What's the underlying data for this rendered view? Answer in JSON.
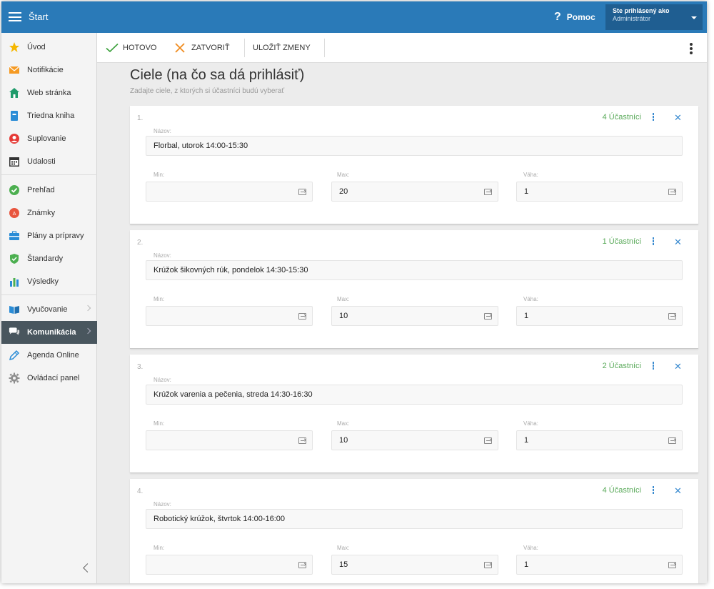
{
  "topbar": {
    "title": "Štart",
    "help_icon": "?",
    "help_label": "Pomoc",
    "user_line1": "Ste prihlásený ako",
    "user_line2": "Administrátor",
    "bg_color": "#2a7ab8"
  },
  "sidebar": {
    "items": [
      {
        "label": "Úvod",
        "icon": "star-icon"
      },
      {
        "label": "Notifikácie",
        "icon": "envelope-icon"
      },
      {
        "label": "Web stránka",
        "icon": "home-icon"
      },
      {
        "label": "Triedna kniha",
        "icon": "book-icon"
      },
      {
        "label": "Suplovanie",
        "icon": "substitute-icon"
      },
      {
        "label": "Udalosti",
        "icon": "calendar-icon"
      },
      {
        "label": "Prehľad",
        "icon": "check-circle-icon"
      },
      {
        "label": "Známky",
        "icon": "grades-icon"
      },
      {
        "label": "Plány a prípravy",
        "icon": "briefcase-icon"
      },
      {
        "label": "Štandardy",
        "icon": "shield-icon"
      },
      {
        "label": "Výsledky",
        "icon": "bar-chart-icon"
      },
      {
        "label": "Vyučovanie",
        "icon": "open-book-icon"
      },
      {
        "label": "Komunikácia",
        "icon": "chat-icon"
      },
      {
        "label": "Agenda Online",
        "icon": "pen-icon"
      },
      {
        "label": "Ovládací panel",
        "icon": "gear-icon"
      }
    ],
    "active_color": "#49565e"
  },
  "toolbar": {
    "done_label": "HOTOVO",
    "close_label": "ZATVORIŤ",
    "save_label": "ULOŽIŤ ZMENY"
  },
  "main": {
    "title": "Ciele (na čo sa dá prihlásiť)",
    "subtitle": "Zadajte ciele, z ktorých si účastníci budú vyberať",
    "name_label": "Názov:",
    "min_label": "Min:",
    "max_label": "Max:",
    "weight_label": "Váha:",
    "cards": [
      {
        "num": "1.",
        "count": "4 Účastníci",
        "name": "Florbal, utorok 14:00-15:30",
        "min": "",
        "max": "20",
        "weight": "1"
      },
      {
        "num": "2.",
        "count": "1 Účastníci",
        "name": "Krúžok šikovných rúk, pondelok 14:30-15:30",
        "min": "",
        "max": "10",
        "weight": "1"
      },
      {
        "num": "3.",
        "count": "2 Účastníci",
        "name": "Krúžok varenia a pečenia, streda 14:30-16:30",
        "min": "",
        "max": "10",
        "weight": "1"
      },
      {
        "num": "4.",
        "count": "4 Účastníci",
        "name": "Robotický krúžok, štvrtok 14:00-16:00",
        "min": "",
        "max": "15",
        "weight": "1"
      }
    ],
    "count_color": "#5aaa5a",
    "action_color": "#3a8bd0"
  }
}
